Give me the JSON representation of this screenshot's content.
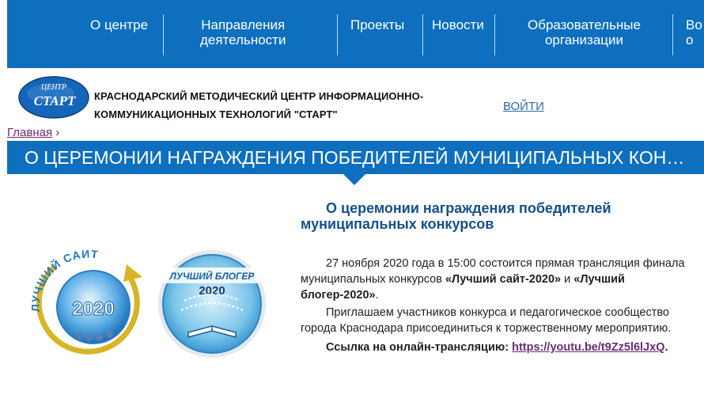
{
  "nav": {
    "items": [
      {
        "line1": "О центре",
        "line2": ""
      },
      {
        "line1": "Направления",
        "line2": "деятельности"
      },
      {
        "line1": "Проекты",
        "line2": ""
      },
      {
        "line1": "Новости",
        "line2": ""
      },
      {
        "line1": "Образовательные",
        "line2": "организации"
      },
      {
        "line1": "Во",
        "line2": "о"
      }
    ]
  },
  "header": {
    "logo_top": "ЦЕНТР",
    "logo_main": "СТАРТ",
    "title_line1": "КРАСНОДАРСКИЙ МЕТОДИЧЕСКИЙ ЦЕНТР ИНФОРМАЦИОННО-",
    "title_line2": "КОММУНИКАЦИОННЫХ ТЕХНОЛОГИЙ \"СТАРТ\"",
    "login": "ВОЙТИ"
  },
  "breadcrumb": {
    "home": "Главная",
    "sep": "›"
  },
  "page_title": "О ЦЕРЕМОНИИ НАГРАЖДЕНИЯ ПОБЕДИТЕЛЕЙ МУНИЦИПАЛЬНЫХ КОН…",
  "article": {
    "title": "О церемонии награждения победителей муниципальных конкурсов",
    "p1_text": "27 ноября 2020 года в 15:00 состоится прямая трансляция финала муниципальных конкурсов ",
    "p1_b1": "«Лучший сайт-2020»",
    "p1_and": " и ",
    "p1_b2": "«Лучший блогер-2020»",
    "p1_end": ".",
    "p2": "Приглашаем участников конкурса и педагогическое сообщество города Краснодара присоединиться к торжественному мероприятию.",
    "p3_label": "Ссылка на онлайн-трансляцию: ",
    "p3_link": "https://youtu.be/t9Zz5l6lJxQ",
    "p3_end": "."
  },
  "badges": {
    "site_text": "ЛУЧШИЙ САЙТ",
    "site_year": "2020",
    "blog_text": "ЛУЧШИЙ БЛОГЕР",
    "blog_year": "2020"
  },
  "colors": {
    "brand": "#0d6fbd",
    "title": "#15508a",
    "visited_link": "#6b2a78"
  }
}
